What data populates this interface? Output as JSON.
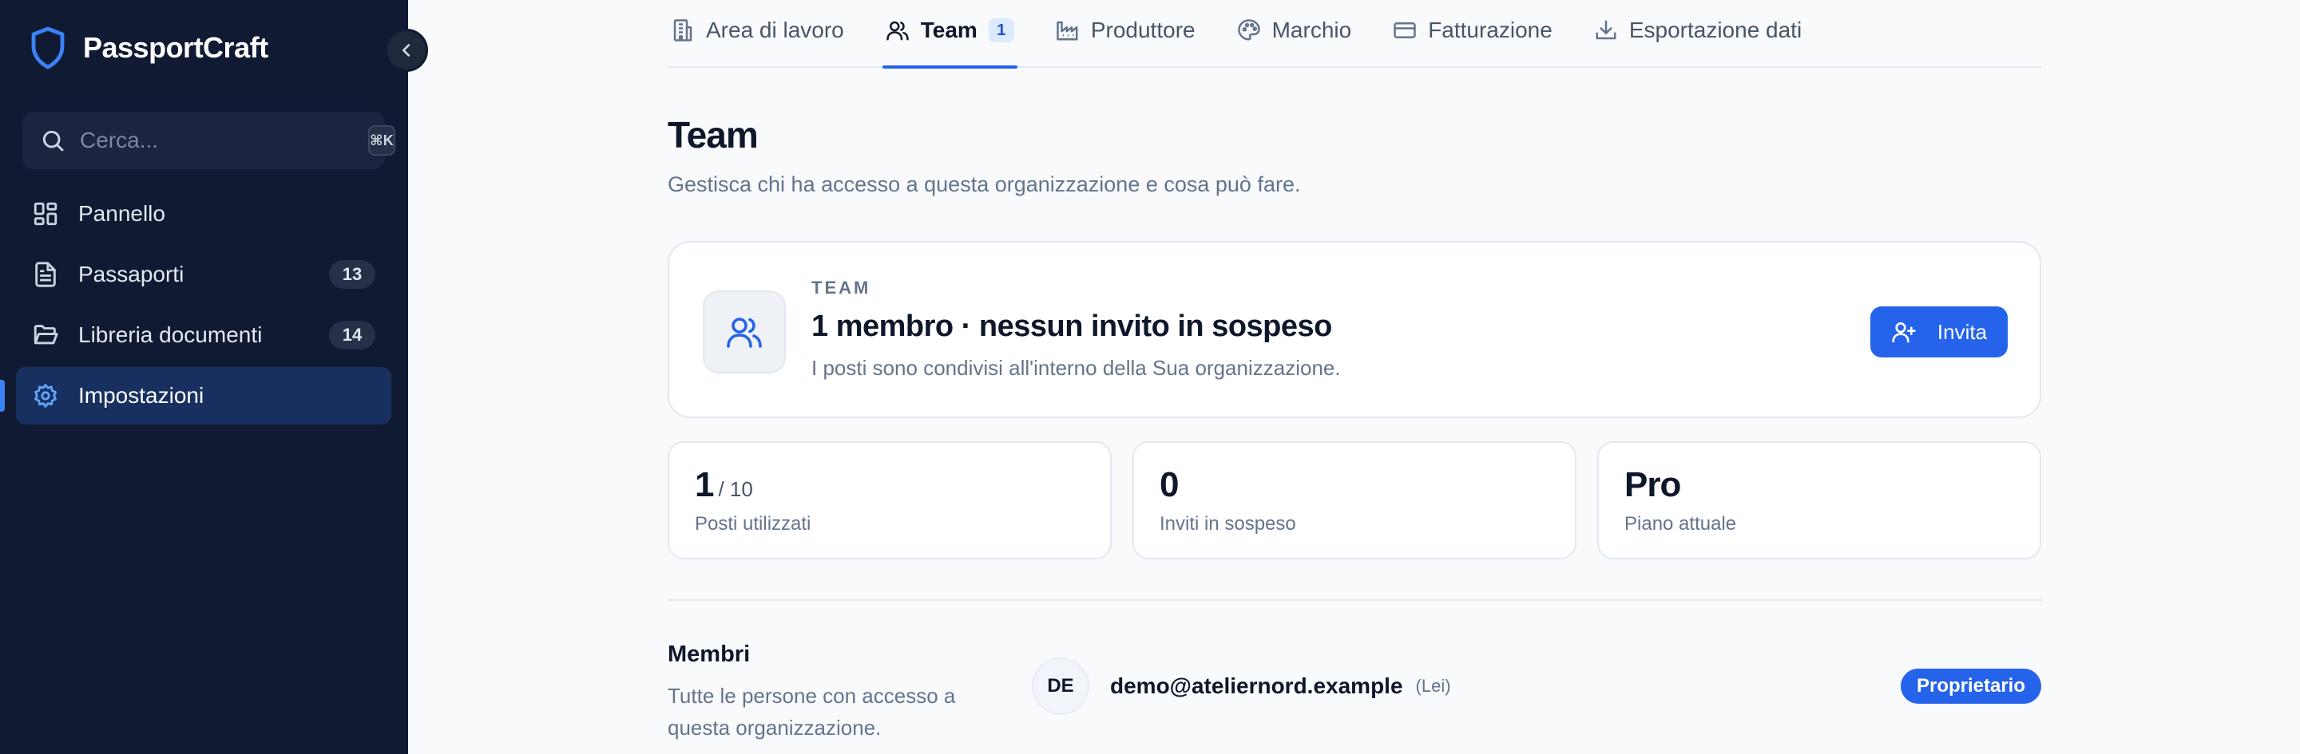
{
  "sidebar": {
    "brand": "PassportCraft",
    "search_placeholder": "Cerca...",
    "search_shortcut": "⌘K",
    "items": [
      {
        "label": "Pannello",
        "icon": "dashboard-icon",
        "count": ""
      },
      {
        "label": "Passaporti",
        "icon": "file-text-icon",
        "count": "13"
      },
      {
        "label": "Libreria documenti",
        "icon": "folder-open-icon",
        "count": "14"
      },
      {
        "label": "Impostazioni",
        "icon": "gear-icon",
        "count": "",
        "active": true
      }
    ]
  },
  "tabs": [
    {
      "label": "Area di lavoro",
      "icon": "building-icon"
    },
    {
      "label": "Team",
      "icon": "users-icon",
      "count": "1",
      "active": true
    },
    {
      "label": "Produttore",
      "icon": "factory-icon"
    },
    {
      "label": "Marchio",
      "icon": "palette-icon"
    },
    {
      "label": "Fatturazione",
      "icon": "credit-card-icon"
    },
    {
      "label": "Esportazione dati",
      "icon": "download-icon"
    }
  ],
  "page": {
    "title": "Team",
    "subtitle": "Gestisca chi ha accesso a questa organizzazione e cosa può fare."
  },
  "team_card": {
    "eyebrow": "TEAM",
    "headline": "1 membro · nessun invito in sospeso",
    "description": "I posti sono condivisi all'interno della Sua organizzazione.",
    "invite_label": "Invita"
  },
  "stats": [
    {
      "value": "1",
      "suffix": "/ 10",
      "label": "Posti utilizzati"
    },
    {
      "value": "0",
      "suffix": "",
      "label": "Inviti in sospeso"
    },
    {
      "value": "Pro",
      "suffix": "",
      "label": "Piano attuale"
    }
  ],
  "members": {
    "title": "Membri",
    "description": "Tutte le persone con accesso a questa organizzazione.",
    "rows": [
      {
        "initials": "DE",
        "email": "demo@ateliernord.example",
        "you_label": "(Lei)",
        "role": "Proprietario"
      }
    ]
  },
  "colors": {
    "sidebar_bg": "#111a33",
    "accent": "#2563eb",
    "active_nav": "#17305f"
  }
}
